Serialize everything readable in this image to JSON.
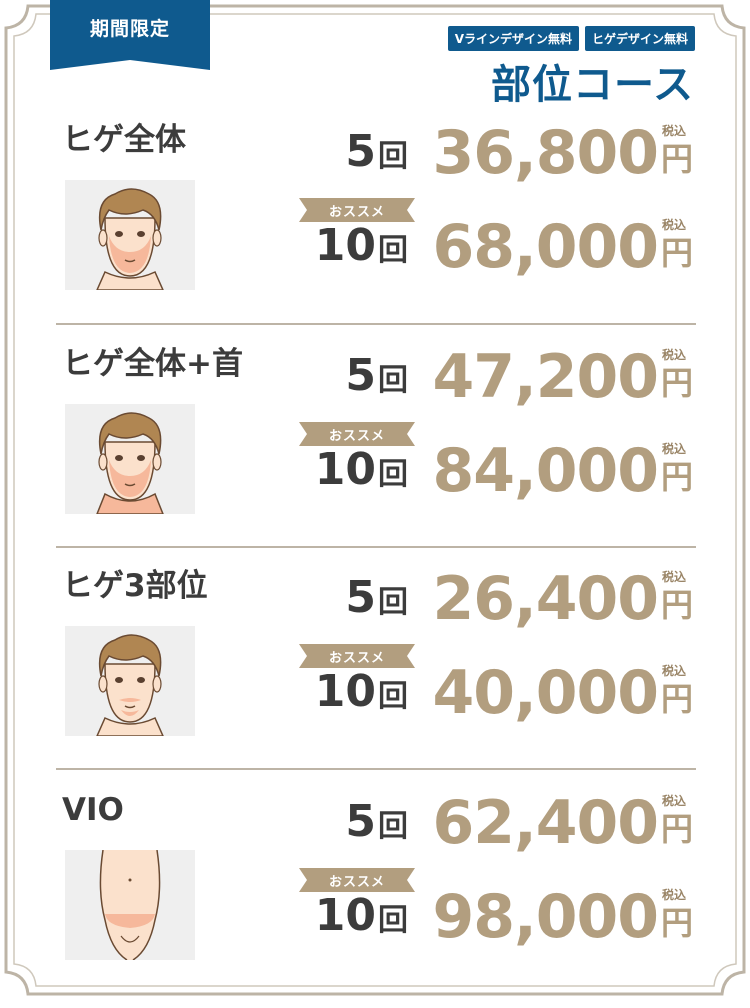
{
  "banner": {
    "label": "期間限定"
  },
  "tags": [
    "Vラインデザイン無料",
    "ヒゲデザイン無料"
  ],
  "course_title": "部位コース",
  "recommend_label": "おススメ",
  "tax_label": "税込",
  "yen_label": "円",
  "count_unit": "回",
  "sections": [
    {
      "name": "ヒゲ全体",
      "illustration": "face-beard-full",
      "plans": [
        {
          "count": "5",
          "price": "36,800"
        },
        {
          "count": "10",
          "price": "68,000"
        }
      ]
    },
    {
      "name": "ヒゲ全体+首",
      "illustration": "face-beard-neck",
      "plans": [
        {
          "count": "5",
          "price": "47,200"
        },
        {
          "count": "10",
          "price": "84,000"
        }
      ]
    },
    {
      "name": "ヒゲ3部位",
      "illustration": "face-beard-3",
      "plans": [
        {
          "count": "5",
          "price": "26,400"
        },
        {
          "count": "10",
          "price": "40,000"
        }
      ]
    },
    {
      "name": "VIO",
      "illustration": "body-vio",
      "plans": [
        {
          "count": "5",
          "price": "62,400"
        },
        {
          "count": "10",
          "price": "98,000"
        }
      ]
    }
  ],
  "colors": {
    "blue": "#0f5a8e",
    "gold": "#b29e7f",
    "text": "#3c3c3c",
    "frame": "#bdb4a6",
    "highlight": "#f6b89b"
  }
}
